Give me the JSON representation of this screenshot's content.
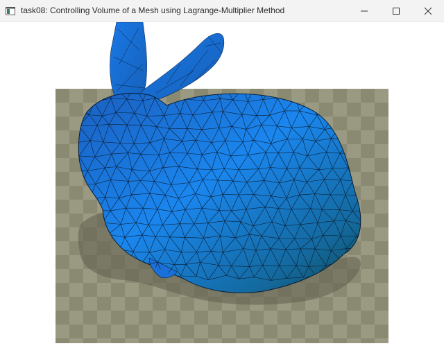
{
  "window": {
    "title": "task08: Controlling Volume of a Mesh using Lagrange-Multiplier Method",
    "app_icon": "window-app-icon",
    "controls": [
      "minimize-icon",
      "maximize-icon",
      "close-icon"
    ]
  },
  "viewport": {
    "content": "shaded triangle mesh (bunny) over checkerboard floor with shadow",
    "colors": {
      "background": "#ffffff",
      "floor_light": "#9a9a82",
      "floor_dark": "#8a8a72",
      "shadow": "#5e5e4e",
      "mesh_base": "#1a78e6",
      "mesh_edge": "#000000"
    }
  }
}
